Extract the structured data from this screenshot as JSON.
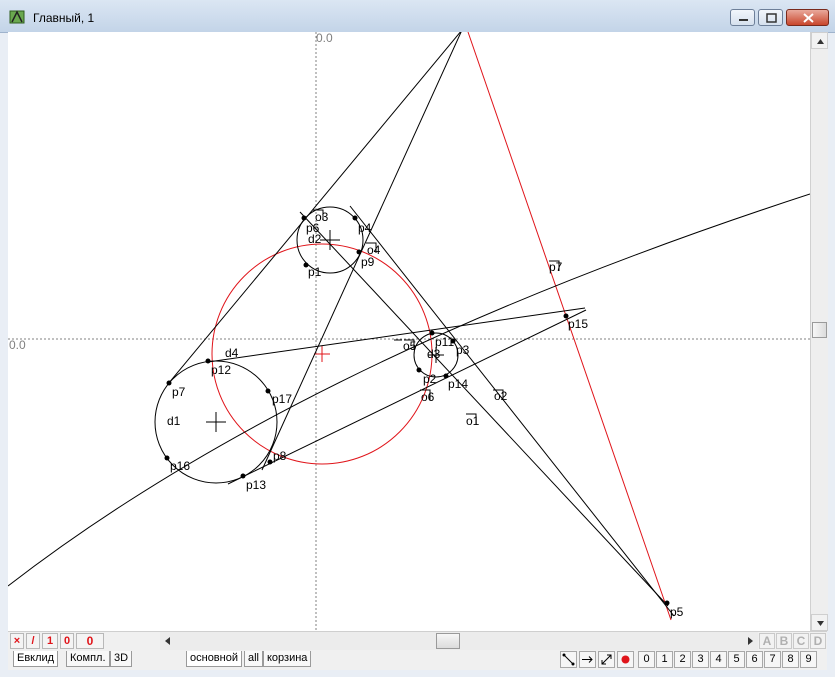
{
  "window": {
    "title": "Главный, 1",
    "controls": [
      "minimize",
      "maximize",
      "close"
    ]
  },
  "axes": {
    "x_origin_label": "0.0",
    "y_origin_label": "0.0"
  },
  "labels": {
    "o3": "o3",
    "p6": "p6",
    "d2": "d2",
    "p4": "p4",
    "o4": "o4",
    "p9": "p9",
    "p1": "p1",
    "p7": "p7",
    "p15": "p15",
    "p11": "p11",
    "o5": "o5",
    "d3": "d3",
    "p3": "p3",
    "p2": "p2",
    "p14": "p14",
    "d4": "d4",
    "p12": "p12",
    "p7b": "p7",
    "p17": "p17",
    "o6": "o6",
    "o2": "o2",
    "d1": "d1",
    "o1": "o1",
    "p8": "p8",
    "p16": "p16",
    "p13": "p13",
    "p5": "p5"
  },
  "status": {
    "marks": [
      "×",
      "/",
      "1",
      "0"
    ],
    "counter": "0"
  },
  "tabs": [
    "Евклид",
    "Компл.",
    "3D",
    "основной",
    "all",
    "корзина"
  ],
  "layer_letters": [
    "A",
    "B",
    "C",
    "D"
  ],
  "layer_numbers": [
    "0",
    "1",
    "2",
    "3",
    "4",
    "5",
    "6",
    "7",
    "8",
    "9"
  ],
  "up_arrow": "↑",
  "colors": {
    "construction_red": "#e0141a",
    "line": "#000000",
    "axis": "#808080"
  }
}
